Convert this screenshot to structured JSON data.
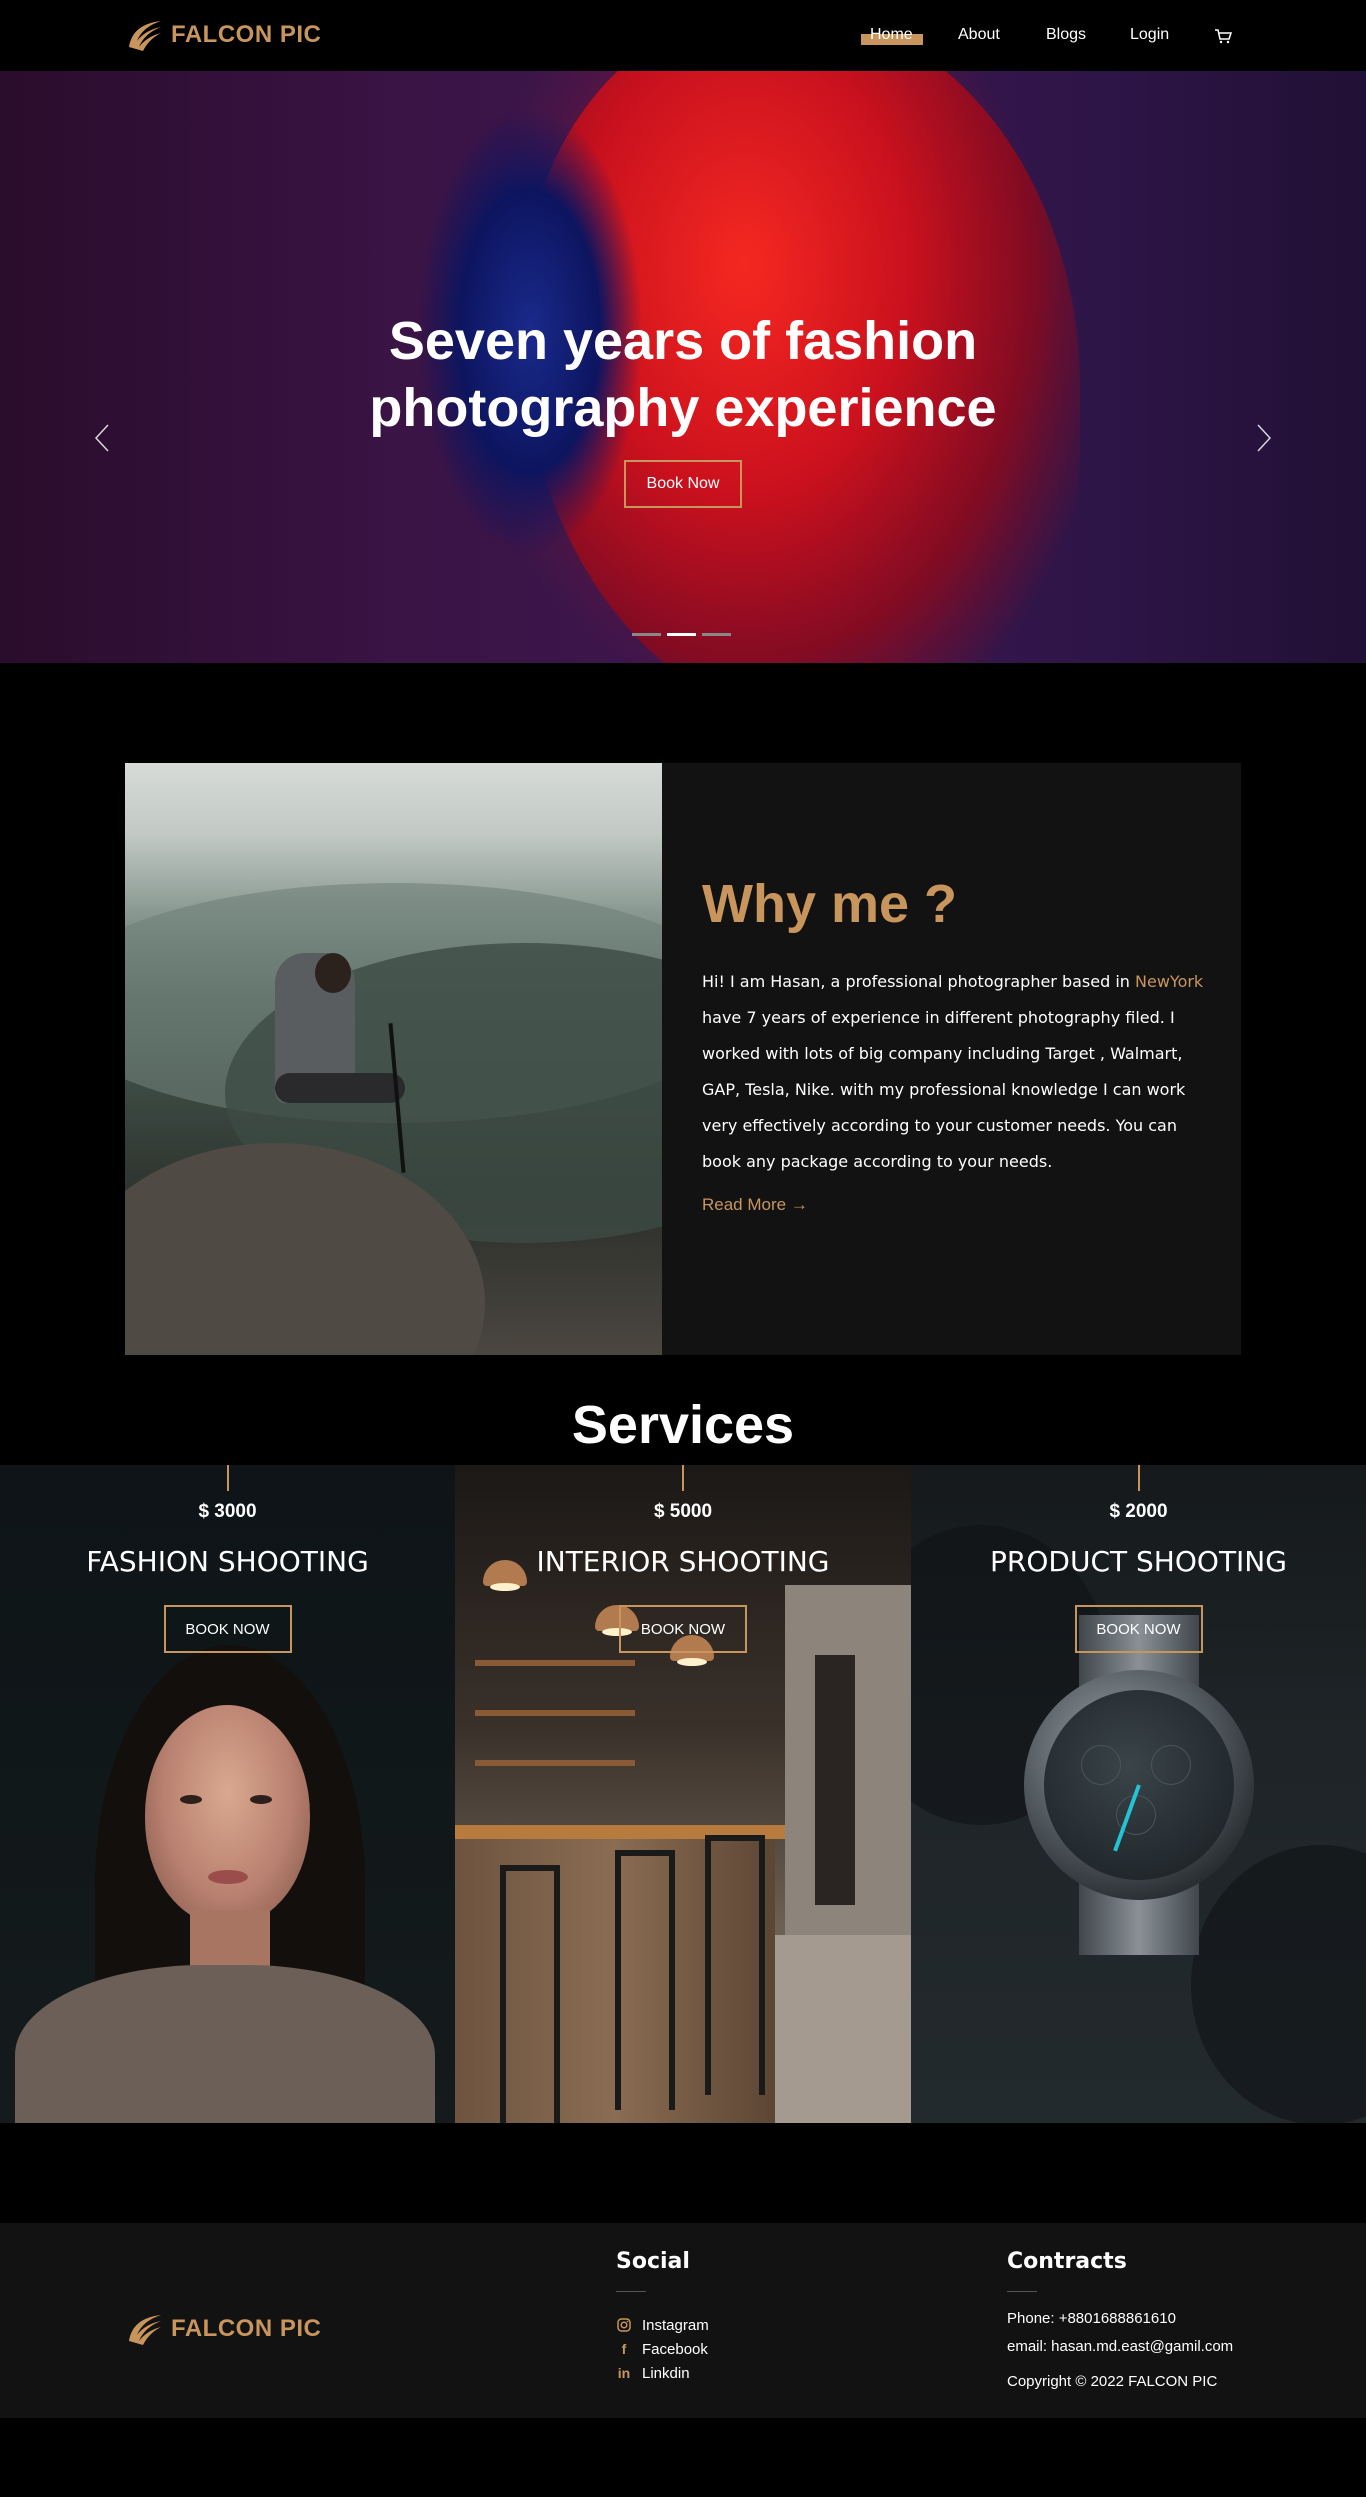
{
  "brand": {
    "name": "FALCON PIC",
    "accent": "#c8955c"
  },
  "nav": {
    "home": "Home",
    "about": "About",
    "blogs": "Blogs",
    "login": "Login",
    "cart_icon": "cart-icon"
  },
  "hero": {
    "title_line1": "Seven years of fashion",
    "title_line2": "photography experience",
    "button": "Book Now",
    "slides": 3,
    "active_slide": 2
  },
  "why": {
    "title": "Why me ?",
    "text_before": "Hi! I am Hasan, a professional photographer based in ",
    "highlight": "NewYork",
    "text_after": " have 7 years of experience in different photography filed. I worked with lots of big company including Target , Walmart, GAP, Tesla, Nike. with my professional knowledge I can work very effectively according to your customer needs. You can book any package according to your needs.",
    "read_more": "Read More →"
  },
  "services": {
    "title": "Services",
    "items": [
      {
        "price": "$ 3000",
        "name": "FASHION SHOOTING",
        "button": "BOOK NOW"
      },
      {
        "price": "$ 5000",
        "name": "INTERIOR SHOOTING",
        "button": "BOOK NOW"
      },
      {
        "price": "$ 2000",
        "name": "PRODUCT SHOOTING",
        "button": "BOOK NOW"
      }
    ]
  },
  "footer": {
    "social_title": "Social",
    "social": [
      {
        "icon": "instagram-icon",
        "label": "Instagram"
      },
      {
        "icon": "facebook-icon",
        "label": "Facebook"
      },
      {
        "icon": "linkedin-icon",
        "label": "Linkdin"
      }
    ],
    "contact_title": "Contracts",
    "phone": "Phone: +8801688861610",
    "email": "email: hasan.md.east@gamil.com",
    "copyright": "Copyright © 2022 FALCON PIC"
  }
}
